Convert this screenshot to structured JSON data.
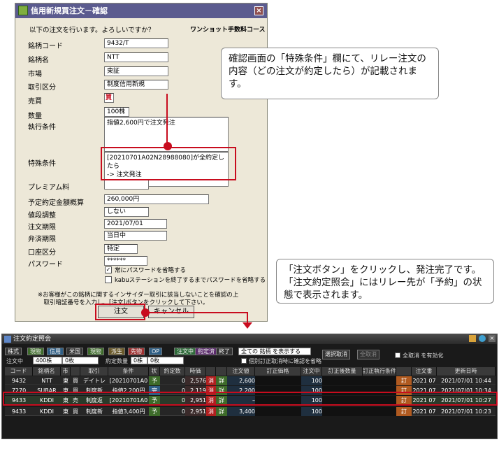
{
  "dialog": {
    "title": "信用新規買注文－確認",
    "confirm_text": "以下の注文を行います。よろしいですか？",
    "course": "ワンショット手数料コース",
    "fields": [
      {
        "label": "銘柄コード",
        "value": "9432/T"
      },
      {
        "label": "銘柄名",
        "value": "NTT"
      },
      {
        "label": "市場",
        "value": "東証"
      },
      {
        "label": "取引区分",
        "value": "制度信用新規"
      },
      {
        "label": "売買",
        "value": "買"
      },
      {
        "label": "数量",
        "value": "100株"
      },
      {
        "label": "執行条件",
        "value": "指値2,600円で注文発注"
      },
      {
        "label": "特殊条件",
        "value": "[20210701A02N28988080]が全約定したら\n-> 注文発注"
      },
      {
        "label": "プレミアム料",
        "value": ""
      },
      {
        "label": "予定約定金額概算",
        "value": "260,000円"
      },
      {
        "label": "値段調整",
        "value": "しない"
      },
      {
        "label": "注文期限",
        "value": "2021/07/01"
      },
      {
        "label": "弁済期限",
        "value": "当日中"
      },
      {
        "label": "口座区分",
        "value": "特定"
      },
      {
        "label": "パスワード",
        "value": "******"
      }
    ],
    "checkbox1": "常にパスワードを省略する",
    "checkbox2": "kabuステーションを終了するまでパスワードを省略する",
    "notice": "※お客様がこの銘柄に関するインサイダー取引に該当しないことを確認の上\n　取引暗証番号を入力し、[注文]ボタンをクリックして下さい。",
    "order_button": "注文",
    "cancel_button": "キャンセル"
  },
  "callout1": "確認画面の「特殊条件」欄にて、リレー注文の内容（どの注文が約定したら）が記載されます。",
  "callout2": "「注文ボタン」をクリックし、発注完了です。「注文約定照会」にはリレー先が「予約」の状態で表示されます。",
  "window": {
    "title": "注文約定照会",
    "filter_tabs": [
      "株式",
      "現物",
      "信用",
      "米国",
      "現物",
      "派生",
      "先物",
      "OP"
    ],
    "status_tabs": [
      "注文中",
      "約定済",
      "終了"
    ],
    "select_value": "全ての 銘柄 を表示する",
    "select_cancel": "選択取消",
    "all_cancel": "全取消",
    "all_cancel_check": "全取消 を有効化",
    "confirm_skip": "個別訂正取消時に確認を省略",
    "summary_label1": "注文中",
    "summary_val1": "400株",
    "summary_val1b": "0枚",
    "summary_label2": "約定数量",
    "summary_val2": "0株",
    "summary_val2b": "0枚",
    "headers": [
      "コード",
      "銘柄名",
      "市",
      "",
      "取引",
      "条件",
      "状",
      "約定数",
      "時価",
      "",
      "",
      "注文値",
      "訂正価格",
      "注文中",
      "訂正後数量",
      "訂正執行条件",
      "",
      "注文番",
      "更新日時"
    ],
    "rows": [
      [
        "9432",
        "NTT",
        "東",
        "買",
        "デイトレ",
        "[20210701A0",
        "予",
        "0",
        "2,576",
        "消",
        "詳",
        "2,600",
        "",
        "100",
        "",
        "",
        "訂",
        "2021 07",
        "2021/07/01 10:44"
      ],
      [
        "7270",
        "SUBAR",
        "東",
        "買",
        "制度新",
        "指値2,200円",
        "完",
        "0",
        "2,119",
        "消",
        "詳",
        "2,200",
        "",
        "100",
        "",
        "",
        "訂",
        "2021 07",
        "2021/07/01 10:34"
      ],
      [
        "9433",
        "KDDI",
        "東",
        "売",
        "制度返",
        "[20210701A0",
        "予",
        "0",
        "2,951",
        "消",
        "詳",
        "–",
        "",
        "100",
        "",
        "",
        "訂",
        "2021 07",
        "2021/07/01 10:27"
      ],
      [
        "9433",
        "KDDI",
        "東",
        "買",
        "制度新",
        "指値3,400円",
        "予",
        "0",
        "2,951",
        "消",
        "詳",
        "3,400",
        "",
        "100",
        "",
        "",
        "訂",
        "2021 07",
        "2021/07/01 10:23"
      ]
    ]
  }
}
